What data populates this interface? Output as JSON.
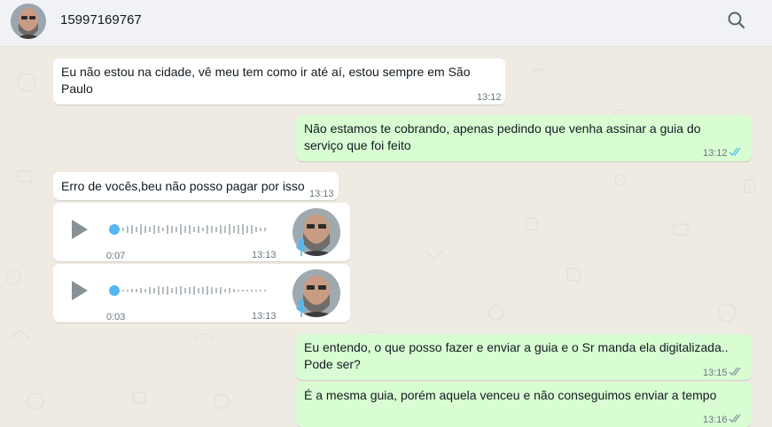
{
  "header": {
    "contact_name": "15997169767",
    "search_icon": "search-icon",
    "avatar_icon": "avatar"
  },
  "colors": {
    "header_bg": "#f0f2f5",
    "chat_bg": "#efeae2",
    "incoming_bubble": "#ffffff",
    "outgoing_bubble": "#d9fdd3",
    "read_ticks": "#53bdeb",
    "voice_dot": "#54b8ef",
    "mic": "#54b8ef"
  },
  "messages": [
    {
      "direction": "in",
      "text_line1": "Eu não estou na cidade, vê meu tem como ir até aí, estou sempre em São",
      "text_line2": "Paulo",
      "time": "13:12"
    },
    {
      "direction": "out",
      "text_line1": "Não estamos te cobrando, apenas pedindo que venha assinar a guia do",
      "text_line2": "serviço que foi feito",
      "time": "13:12",
      "status": "read"
    },
    {
      "direction": "in",
      "text": "Erro de vocês,beu não posso pagar por isso",
      "time": "13:13"
    },
    {
      "direction": "in",
      "type": "voice",
      "duration": "0:07",
      "time": "13:13",
      "progress": 0
    },
    {
      "direction": "in",
      "type": "voice",
      "duration": "0:03",
      "time": "13:13",
      "progress": 0
    },
    {
      "direction": "out",
      "text_line1": "Eu entendo, o que posso fazer e enviar a guia e o Sr manda ela digitalizada..",
      "text_line2": "Pode ser?",
      "time": "13:15",
      "status": "read"
    },
    {
      "direction": "out",
      "text": "É a mesma guia, porém aquela venceu e não conseguimos enviar a tempo",
      "time": "13:16",
      "status": "read"
    }
  ]
}
